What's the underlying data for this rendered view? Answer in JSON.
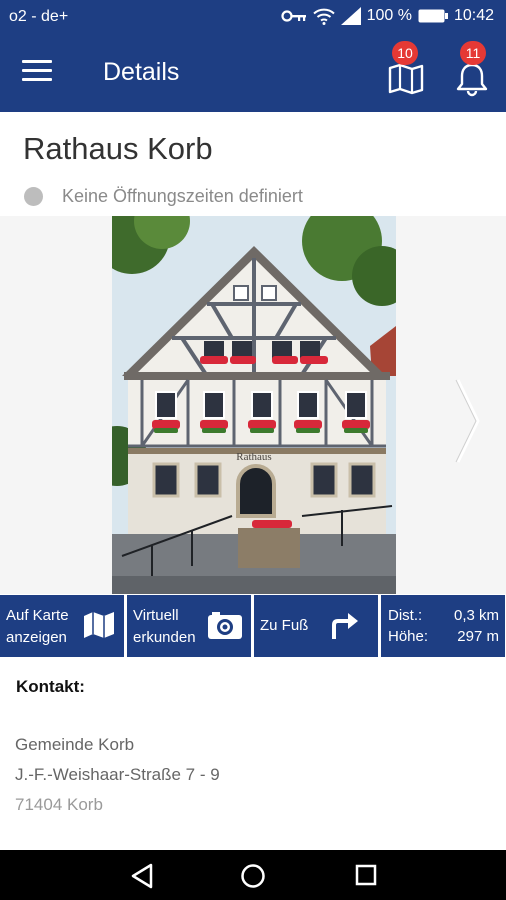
{
  "status_bar": {
    "carrier": "o2 - de+",
    "battery": "100 %",
    "time": "10:42"
  },
  "app_bar": {
    "title": "Details",
    "map_badge": "10",
    "bell_badge": "11"
  },
  "place": {
    "title": "Rathaus Korb",
    "hours_text": "Keine Öffnungszeiten definiert"
  },
  "photo": {
    "sign_text": "Rathaus"
  },
  "actions": {
    "map_line1": "Auf Karte",
    "map_line2": "anzeigen",
    "virtual_line1": "Virtuell",
    "virtual_line2": "erkunden",
    "walk_label": "Zu Fuß",
    "dist_label": "Dist.:",
    "dist_value": "0,3 km",
    "height_label": "Höhe:",
    "height_value": "297 m"
  },
  "contact": {
    "heading": "Kontakt:",
    "lines": [
      "Gemeinde Korb",
      "J.-F.-Weishaar-Straße 7 - 9",
      "71404 Korb"
    ]
  },
  "colors": {
    "primary": "#1e3e83",
    "badge": "#e53935",
    "status_dot": "#bdbdbd"
  },
  "icons": [
    "key-icon",
    "wifi-icon",
    "signal-icon",
    "battery-icon",
    "menu-icon",
    "map-book-icon",
    "bell-icon",
    "chevron-right-icon",
    "map-icon",
    "camera-icon",
    "turn-right-arrow-icon",
    "back-nav-icon",
    "home-nav-icon",
    "recents-nav-icon"
  ]
}
